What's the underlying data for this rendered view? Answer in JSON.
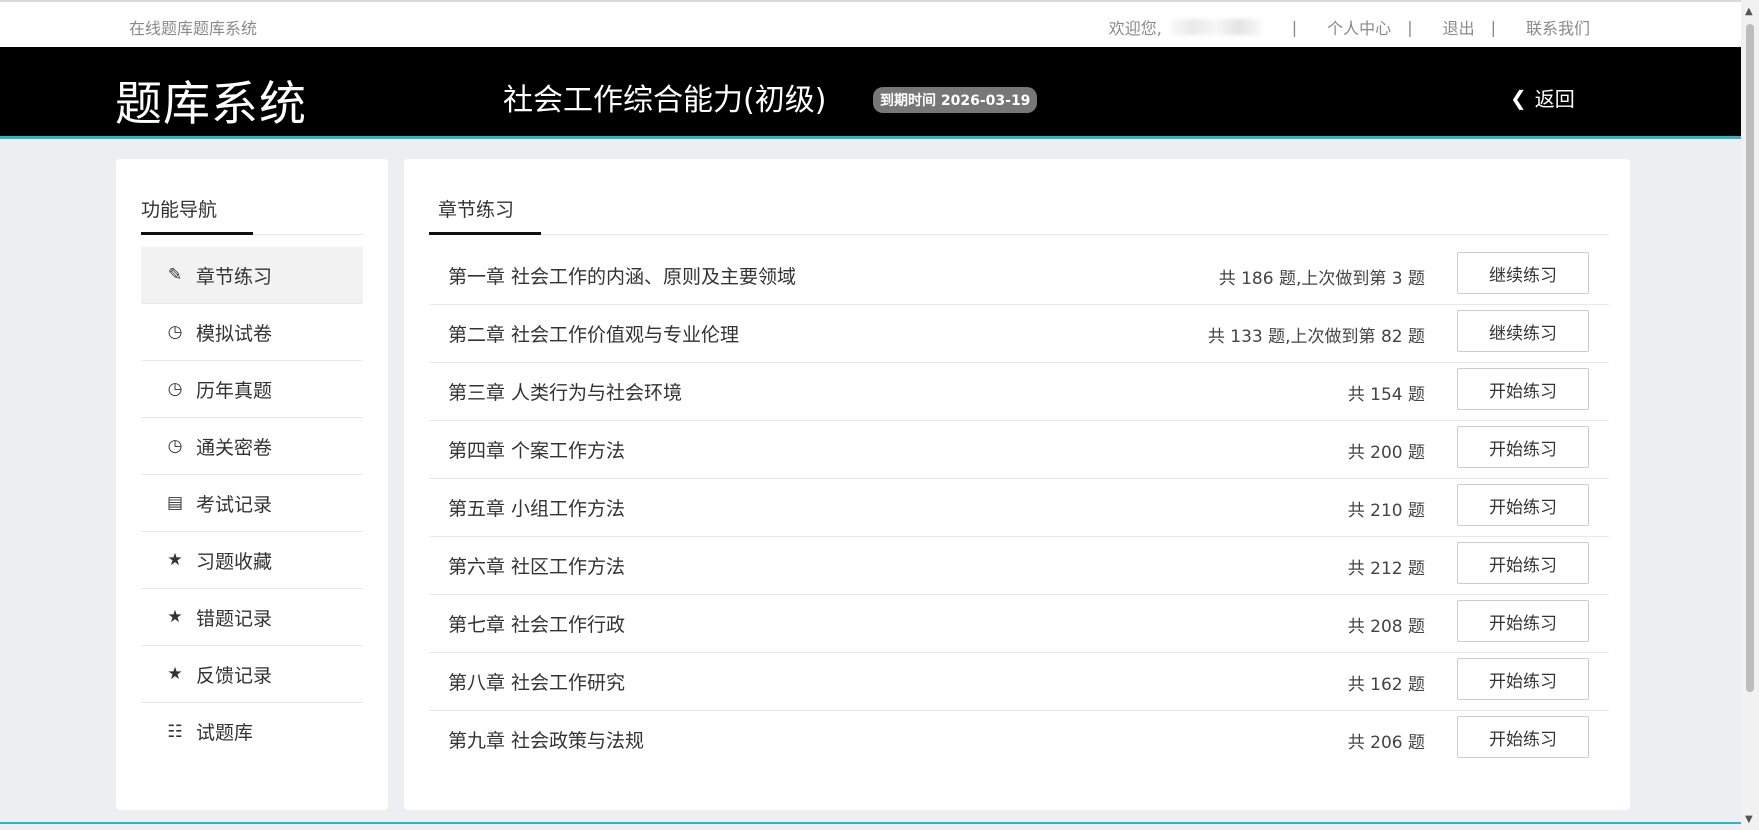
{
  "topbar": {
    "site_name": "在线题库题库系统",
    "welcome": "欢迎您,",
    "links": [
      "个人中心",
      "退出",
      "联系我们"
    ],
    "separator": "|"
  },
  "header": {
    "logo": "题库系统",
    "course_title": "社会工作综合能力(初级)",
    "expiry": "到期时间 2026-03-19",
    "back_label": "返回",
    "accent_color": "#2ab7c8"
  },
  "sidebar": {
    "title": "功能导航",
    "items": [
      {
        "label": "章节练习",
        "icon": "pencil-icon",
        "active": true
      },
      {
        "label": "模拟试卷",
        "icon": "clock-icon"
      },
      {
        "label": "历年真题",
        "icon": "clock-icon"
      },
      {
        "label": "通关密卷",
        "icon": "clock-icon"
      },
      {
        "label": "考试记录",
        "icon": "list-icon"
      },
      {
        "label": "习题收藏",
        "icon": "star-icon"
      },
      {
        "label": "错题记录",
        "icon": "star-icon"
      },
      {
        "label": "反馈记录",
        "icon": "star-icon"
      },
      {
        "label": "试题库",
        "icon": "grid-icon"
      }
    ]
  },
  "main": {
    "tab": "章节练习",
    "chapters": [
      {
        "name": "第一章 社会工作的内涵、原则及主要领域",
        "count": "共 186 题,上次做到第 3 题",
        "button": "继续练习"
      },
      {
        "name": "第二章 社会工作价值观与专业伦理",
        "count": "共 133 题,上次做到第 82 题",
        "button": "继续练习"
      },
      {
        "name": "第三章 人类行为与社会环境",
        "count": "共 154 题",
        "button": "开始练习"
      },
      {
        "name": "第四章 个案工作方法",
        "count": "共 200 题",
        "button": "开始练习"
      },
      {
        "name": "第五章 小组工作方法",
        "count": "共 210 题",
        "button": "开始练习"
      },
      {
        "name": "第六章 社区工作方法",
        "count": "共 212 题",
        "button": "开始练习"
      },
      {
        "name": "第七章 社会工作行政",
        "count": "共 208 题",
        "button": "开始练习"
      },
      {
        "name": "第八章 社会工作研究",
        "count": "共 162 题",
        "button": "开始练习"
      },
      {
        "name": "第九章 社会政策与法规",
        "count": "共 206 题",
        "button": "开始练习"
      }
    ]
  }
}
